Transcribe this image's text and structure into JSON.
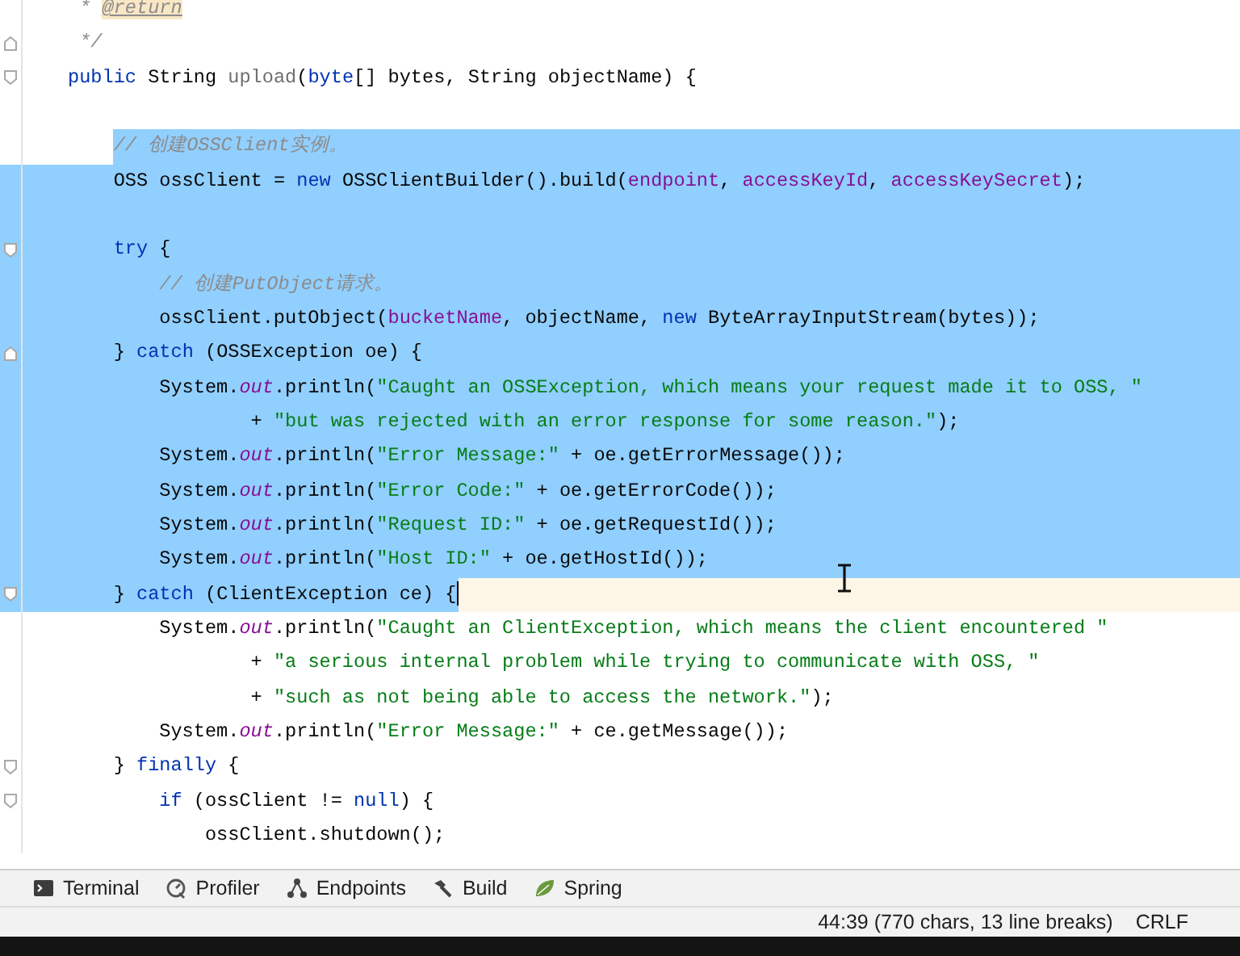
{
  "editor": {
    "lines": [
      {
        "fold_start": false,
        "fold_end": false,
        "selected": false,
        "tokens": [
          {
            "kind": "doc",
            "text": " * "
          },
          {
            "kind": "doc-tag",
            "text": "@return"
          }
        ]
      },
      {
        "fold_start": false,
        "fold_end": true,
        "selected": false,
        "tokens": [
          {
            "kind": "doc",
            "text": " */"
          }
        ]
      },
      {
        "fold_start": true,
        "fold_end": false,
        "selected": false,
        "tokens": [
          {
            "kind": "kw",
            "text": "public"
          },
          {
            "kind": "plain",
            "text": " String "
          },
          {
            "kind": "unused",
            "text": "upload"
          },
          {
            "kind": "plain",
            "text": "("
          },
          {
            "kind": "kw",
            "text": "byte"
          },
          {
            "kind": "plain",
            "text": "[] bytes, String objectName) {"
          }
        ]
      },
      {
        "fold_start": false,
        "fold_end": false,
        "selected": false
      },
      {
        "fold_start": false,
        "fold_end": false,
        "selected": true,
        "tokens": [
          {
            "kind": "comment",
            "text": "    // 创建OSSClient实例。"
          }
        ]
      },
      {
        "fold_start": false,
        "fold_end": false,
        "selected": true,
        "tokens": [
          {
            "kind": "plain",
            "text": "    OSS ossClient = "
          },
          {
            "kind": "kw",
            "text": "new"
          },
          {
            "kind": "plain",
            "text": " OSSClientBuilder().build("
          },
          {
            "kind": "field",
            "text": "endpoint"
          },
          {
            "kind": "plain",
            "text": ", "
          },
          {
            "kind": "field",
            "text": "accessKeyId"
          },
          {
            "kind": "plain",
            "text": ", "
          },
          {
            "kind": "field",
            "text": "accessKeySecret"
          },
          {
            "kind": "plain",
            "text": ");"
          }
        ]
      },
      {
        "fold_start": false,
        "fold_end": false,
        "selected": true
      },
      {
        "fold_start": true,
        "fold_end": false,
        "selected": true,
        "tokens": [
          {
            "kind": "kw",
            "text": "    try"
          },
          {
            "kind": "plain",
            "text": " {"
          }
        ]
      },
      {
        "fold_start": false,
        "fold_end": false,
        "selected": true,
        "tokens": [
          {
            "kind": "comment",
            "text": "        // 创建PutObject请求。"
          }
        ]
      },
      {
        "fold_start": false,
        "fold_end": false,
        "selected": true,
        "tokens": [
          {
            "kind": "plain",
            "text": "        ossClient.putObject("
          },
          {
            "kind": "field",
            "text": "bucketName"
          },
          {
            "kind": "plain",
            "text": ", objectName, "
          },
          {
            "kind": "kw",
            "text": "new"
          },
          {
            "kind": "plain",
            "text": " ByteArrayInputStream(bytes));"
          }
        ]
      },
      {
        "fold_start": false,
        "fold_end": true,
        "selected": true,
        "tokens": [
          {
            "kind": "plain",
            "text": "    } "
          },
          {
            "kind": "kw",
            "text": "catch"
          },
          {
            "kind": "plain",
            "text": " (OSSException oe) {"
          }
        ]
      },
      {
        "fold_start": false,
        "fold_end": false,
        "selected": true,
        "tokens": [
          {
            "kind": "plain",
            "text": "        System."
          },
          {
            "kind": "static",
            "text": "out"
          },
          {
            "kind": "plain",
            "text": ".println("
          },
          {
            "kind": "str",
            "text": "\"Caught an OSSException, which means your request made it to OSS, \""
          }
        ]
      },
      {
        "fold_start": false,
        "fold_end": false,
        "selected": true,
        "tokens": [
          {
            "kind": "plain",
            "text": "                + "
          },
          {
            "kind": "str",
            "text": "\"but was rejected with an error response for some reason.\""
          },
          {
            "kind": "plain",
            "text": ");"
          }
        ]
      },
      {
        "fold_start": false,
        "fold_end": false,
        "selected": true,
        "tokens": [
          {
            "kind": "plain",
            "text": "        System."
          },
          {
            "kind": "static",
            "text": "out"
          },
          {
            "kind": "plain",
            "text": ".println("
          },
          {
            "kind": "str",
            "text": "\"Error Message:\""
          },
          {
            "kind": "plain",
            "text": " + oe.getErrorMessage());"
          }
        ]
      },
      {
        "fold_start": false,
        "fold_end": false,
        "selected": true,
        "tokens": [
          {
            "kind": "plain",
            "text": "        System."
          },
          {
            "kind": "static",
            "text": "out"
          },
          {
            "kind": "plain",
            "text": ".println("
          },
          {
            "kind": "str",
            "text": "\"Error Code:\""
          },
          {
            "kind": "plain",
            "text": " + oe.getErrorCode());"
          }
        ]
      },
      {
        "fold_start": false,
        "fold_end": false,
        "selected": true,
        "tokens": [
          {
            "kind": "plain",
            "text": "        System."
          },
          {
            "kind": "static",
            "text": "out"
          },
          {
            "kind": "plain",
            "text": ".println("
          },
          {
            "kind": "str",
            "text": "\"Request ID:\""
          },
          {
            "kind": "plain",
            "text": " + oe.getRequestId());"
          }
        ]
      },
      {
        "fold_start": false,
        "fold_end": false,
        "selected": true,
        "tokens": [
          {
            "kind": "plain",
            "text": "        System."
          },
          {
            "kind": "static",
            "text": "out"
          },
          {
            "kind": "plain",
            "text": ".println("
          },
          {
            "kind": "str",
            "text": "\"Host ID:\""
          },
          {
            "kind": "plain",
            "text": " + oe.getHostId());"
          }
        ]
      },
      {
        "fold_start": true,
        "fold_end": false,
        "selected": true,
        "tokens": [
          {
            "kind": "plain",
            "text": "    } "
          },
          {
            "kind": "kw",
            "text": "catch"
          },
          {
            "kind": "plain",
            "text": " (ClientException ce) {"
          }
        ]
      },
      {
        "fold_start": false,
        "fold_end": false,
        "selected": false,
        "tokens": [
          {
            "kind": "plain",
            "text": "        System."
          },
          {
            "kind": "static",
            "text": "out"
          },
          {
            "kind": "plain",
            "text": ".println("
          },
          {
            "kind": "str",
            "text": "\"Caught an ClientException, which means the client encountered \""
          }
        ]
      },
      {
        "fold_start": false,
        "fold_end": false,
        "selected": false,
        "tokens": [
          {
            "kind": "plain",
            "text": "                + "
          },
          {
            "kind": "str",
            "text": "\"a serious internal problem while trying to communicate with OSS, \""
          }
        ]
      },
      {
        "fold_start": false,
        "fold_end": false,
        "selected": false,
        "tokens": [
          {
            "kind": "plain",
            "text": "                + "
          },
          {
            "kind": "str",
            "text": "\"such as not being able to access the network.\""
          },
          {
            "kind": "plain",
            "text": ");"
          }
        ]
      },
      {
        "fold_start": false,
        "fold_end": false,
        "selected": false,
        "tokens": [
          {
            "kind": "plain",
            "text": "        System."
          },
          {
            "kind": "static",
            "text": "out"
          },
          {
            "kind": "plain",
            "text": ".println("
          },
          {
            "kind": "str",
            "text": "\"Error Message:\""
          },
          {
            "kind": "plain",
            "text": " + ce.getMessage());"
          }
        ]
      },
      {
        "fold_start": true,
        "fold_end": false,
        "selected": false,
        "tokens": [
          {
            "kind": "plain",
            "text": "    } "
          },
          {
            "kind": "kw",
            "text": "finally"
          },
          {
            "kind": "plain",
            "text": " {"
          }
        ]
      },
      {
        "fold_start": true,
        "fold_end": false,
        "selected": false,
        "tokens": [
          {
            "kind": "kw",
            "text": "        if"
          },
          {
            "kind": "plain",
            "text": " (ossClient != "
          },
          {
            "kind": "kw",
            "text": "null"
          },
          {
            "kind": "plain",
            "text": ") {"
          }
        ]
      },
      {
        "fold_start": false,
        "fold_end": false,
        "selected": false,
        "tokens": [
          {
            "kind": "plain",
            "text": "            ossClient.shutdown();"
          }
        ]
      }
    ]
  },
  "tool_windows": [
    {
      "label": "Terminal"
    },
    {
      "label": "Profiler"
    },
    {
      "label": "Endpoints"
    },
    {
      "label": "Build"
    },
    {
      "label": "Spring"
    }
  ],
  "status_bar": {
    "position": "44:39 (770 chars, 13 line breaks)",
    "line_separator": "CRLF"
  }
}
